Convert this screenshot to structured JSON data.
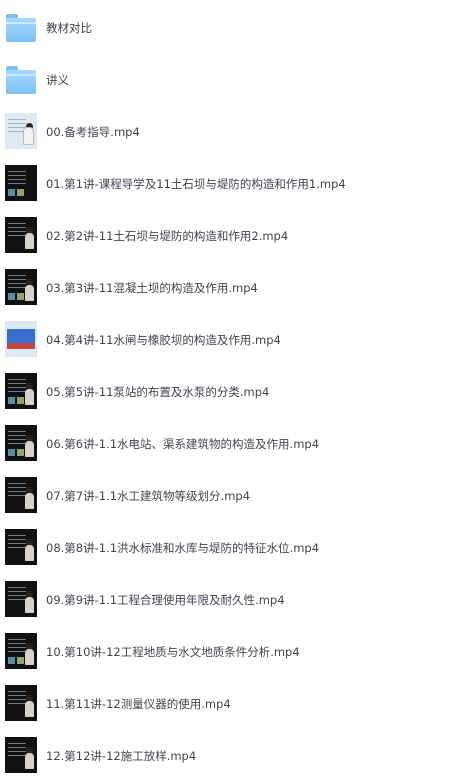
{
  "items": [
    {
      "type": "folder",
      "icon": "folder-icon",
      "label": "教材对比"
    },
    {
      "type": "folder",
      "icon": "folder-icon",
      "label": "讲义"
    },
    {
      "type": "video",
      "icon": "video-thumbnail",
      "thumb": "light",
      "label": "00.备考指导.mp4"
    },
    {
      "type": "video",
      "icon": "video-thumbnail",
      "thumb": "dark",
      "label": "01.第1讲-课程导学及11土石坝与堤防的构造和作用1.mp4"
    },
    {
      "type": "video",
      "icon": "video-thumbnail",
      "thumb": "dark",
      "label": "02.第2讲-11土石坝与堤防的构造和作用2.mp4"
    },
    {
      "type": "video",
      "icon": "video-thumbnail",
      "thumb": "dark",
      "label": "03.第3讲-11混凝土坝的构造及作用.mp4"
    },
    {
      "type": "video",
      "icon": "video-thumbnail",
      "thumb": "blue",
      "label": "04.第4讲-11水闸与橡胶坝的构造及作用.mp4"
    },
    {
      "type": "video",
      "icon": "video-thumbnail",
      "thumb": "dark",
      "label": "05.第5讲-11泵站的布置及水泵的分类.mp4"
    },
    {
      "type": "video",
      "icon": "video-thumbnail",
      "thumb": "dark",
      "label": "06.第6讲-1.1水电站、渠系建筑物的构造及作用.mp4"
    },
    {
      "type": "video",
      "icon": "video-thumbnail",
      "thumb": "dark",
      "label": "07.第7讲-1.1水工建筑物等级划分.mp4"
    },
    {
      "type": "video",
      "icon": "video-thumbnail",
      "thumb": "dark",
      "label": "08.第8讲-1.1洪水标准和水库与堤防的特征水位.mp4"
    },
    {
      "type": "video",
      "icon": "video-thumbnail",
      "thumb": "dark",
      "label": "09.第9讲-1.1工程合理使用年限及耐久性.mp4"
    },
    {
      "type": "video",
      "icon": "video-thumbnail",
      "thumb": "dark",
      "label": "10.第10讲-12工程地质与水文地质条件分析.mp4"
    },
    {
      "type": "video",
      "icon": "video-thumbnail",
      "thumb": "dark",
      "label": "11.第11讲-12测量仪器的使用.mp4"
    },
    {
      "type": "video",
      "icon": "video-thumbnail",
      "thumb": "dark",
      "label": "12.第12讲-12施工放样.mp4"
    }
  ]
}
